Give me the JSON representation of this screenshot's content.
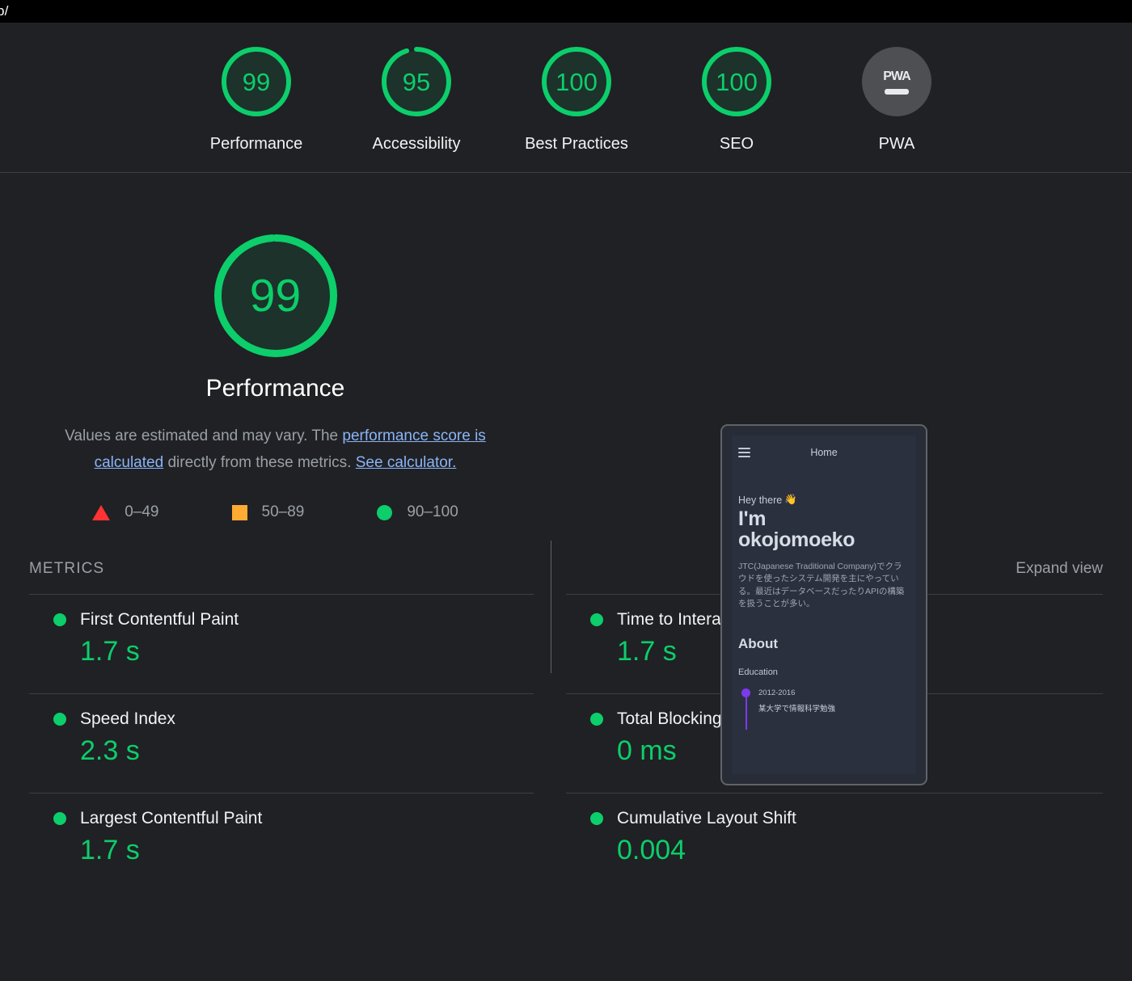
{
  "urlbar": {
    "url": "p/"
  },
  "scores": [
    {
      "label": "Performance",
      "value": "99",
      "pct": 99,
      "color": "#0cce6b",
      "track": "#0cce6b"
    },
    {
      "label": "Accessibility",
      "value": "95",
      "pct": 95,
      "color": "#0cce6b",
      "track": "#0cce6b"
    },
    {
      "label": "Best Practices",
      "value": "100",
      "pct": 100,
      "color": "#0cce6b",
      "track": "#0cce6b"
    },
    {
      "label": "SEO",
      "value": "100",
      "pct": 100,
      "color": "#0cce6b",
      "track": "#0cce6b"
    }
  ],
  "pwa": {
    "label": "PWA",
    "badge_text": "PWA"
  },
  "category": {
    "score": "99",
    "score_pct": 99,
    "title": "Performance",
    "description": {
      "text_1": "Values are estimated and may vary. The ",
      "link_1": "performance score is calculated",
      "text_2": " directly from these metrics. ",
      "link_2": "See calculator."
    },
    "legend": [
      {
        "shape": "triangle-icon",
        "range": "0–49",
        "color": "#ff3333"
      },
      {
        "shape": "square-icon",
        "range": "50–89",
        "color": "#ffaa33"
      },
      {
        "shape": "circle-icon",
        "range": "90–100",
        "color": "#0cce6b"
      }
    ]
  },
  "thumbnail": {
    "nav_title": "Home",
    "greeting": "Hey there",
    "greeting_emoji": "👋",
    "name_line1": "I'm",
    "name_line2": "okojomoeko",
    "bio": "JTC(Japanese Traditional Company)でクラウドを使ったシステム開発を主にやっている。最近はデータベースだったりAPIの構築を扱うことが多い。",
    "about_heading": "About",
    "education_heading": "Education",
    "education_years": "2012-2016",
    "education_desc": "某大学で情報科学勉強"
  },
  "metrics_section": {
    "title": "METRICS",
    "expand_label": "Expand view"
  },
  "metrics": [
    {
      "name": "First Contentful Paint",
      "value": "1.7 s",
      "status": "pass",
      "color": "#0cce6b"
    },
    {
      "name": "Time to Interactive",
      "value": "1.7 s",
      "status": "pass",
      "color": "#0cce6b"
    },
    {
      "name": "Speed Index",
      "value": "2.3 s",
      "status": "pass",
      "color": "#0cce6b"
    },
    {
      "name": "Total Blocking Time",
      "value": "0 ms",
      "status": "pass",
      "color": "#0cce6b"
    },
    {
      "name": "Largest Contentful Paint",
      "value": "1.7 s",
      "status": "pass",
      "color": "#0cce6b"
    },
    {
      "name": "Cumulative Layout Shift",
      "value": "0.004",
      "status": "pass",
      "color": "#0cce6b"
    }
  ],
  "colors": {
    "background": "#202124",
    "pass_green": "#0cce6b",
    "average_orange": "#ffaa33",
    "fail_red": "#ff3333",
    "link_blue": "#8ab4f8",
    "muted_text": "#9aa0a6"
  }
}
